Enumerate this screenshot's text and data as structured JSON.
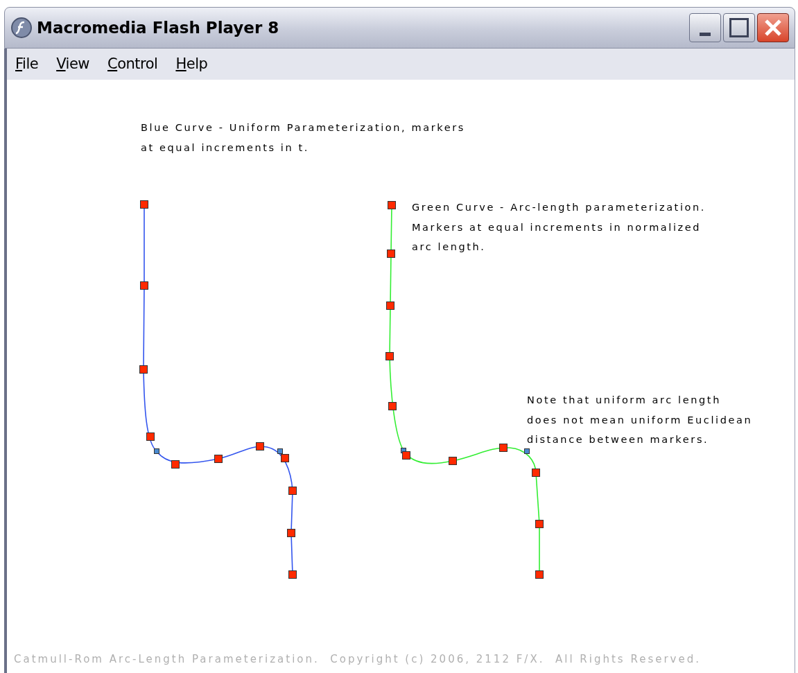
{
  "window": {
    "title": "Macromedia Flash Player 8"
  },
  "menu": [
    {
      "label": "File",
      "mnemonic_first": true
    },
    {
      "label": "View",
      "mnemonic_first": true
    },
    {
      "label": "Control",
      "mnemonic_first": true
    },
    {
      "label": "Help",
      "mnemonic_first": true
    }
  ],
  "notes": [
    {
      "lines": [
        "Blue Curve  - Uniform Parameterization, markers",
        "at equal increments in t."
      ]
    },
    {
      "lines": [
        "Green Curve - Arc-length parameterization.",
        "Markers at equal increments in normalized",
        "arc length."
      ]
    },
    {
      "lines": [
        "Note that uniform arc length",
        "does not mean uniform Euclidean",
        "distance between markers."
      ]
    }
  ],
  "footer": "Catmull-Rom Arc-Length Parameterization.  Copyright (c) 2006, 2112 F/X.  All Rights Reserved."
}
